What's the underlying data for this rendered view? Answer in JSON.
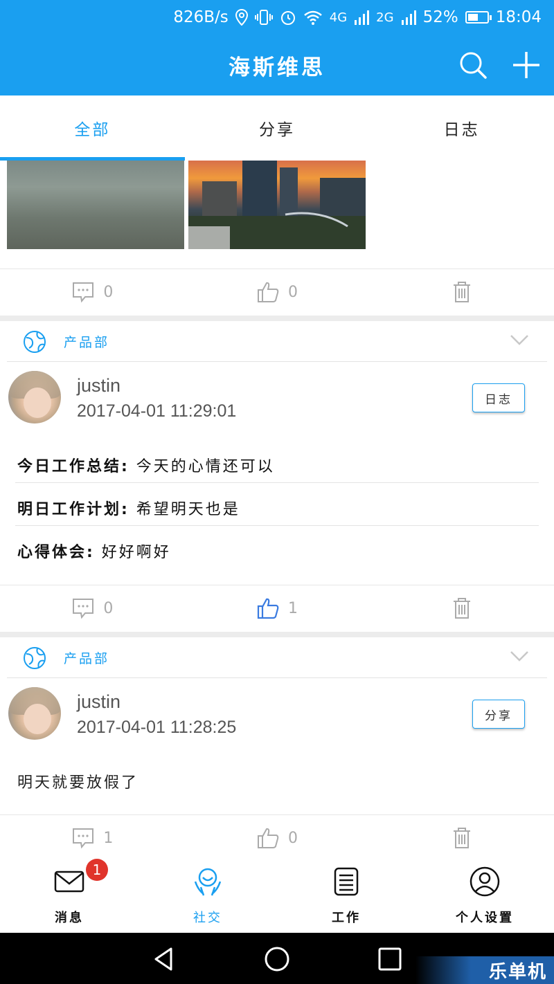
{
  "status_bar": {
    "net_speed": "826B/s",
    "net_4g": "4G",
    "net_2g": "2G",
    "battery": "52%",
    "battery_level": 0.52,
    "time": "18:04"
  },
  "app_bar": {
    "title": "海斯维思"
  },
  "tabs": [
    {
      "label": "全部",
      "active": true
    },
    {
      "label": "分享",
      "active": false
    },
    {
      "label": "日志",
      "active": false
    }
  ],
  "feed": {
    "post0": {
      "comments": "0",
      "likes": "0"
    },
    "post1": {
      "group": "产品部",
      "user": "justin",
      "time": "2017-04-01 11:29:01",
      "tag": "日志",
      "rows": [
        {
          "label": "今日工作总结:",
          "text": " 今天的心情还可以"
        },
        {
          "label": "明日工作计划:",
          "text": " 希望明天也是"
        },
        {
          "label": "心得体会:",
          "text": " 好好啊好"
        }
      ],
      "comments": "0",
      "likes": "1",
      "liked": true
    },
    "post2": {
      "group": "产品部",
      "user": "justin",
      "time": "2017-04-01 11:28:25",
      "tag": "分享",
      "text": "明天就要放假了",
      "comments": "1",
      "likes": "0"
    }
  },
  "bottom_nav": [
    {
      "label": "消息",
      "badge": "1",
      "icon": "mail-icon"
    },
    {
      "label": "社交",
      "icon": "social-icon",
      "active": true
    },
    {
      "label": "工作",
      "icon": "work-icon"
    },
    {
      "label": "个人设置",
      "icon": "user-icon"
    }
  ],
  "watermark": "乐单机",
  "colors": {
    "primary": "#1a9ff0",
    "badge": "#e0342b",
    "like_active": "#3a7be0"
  }
}
